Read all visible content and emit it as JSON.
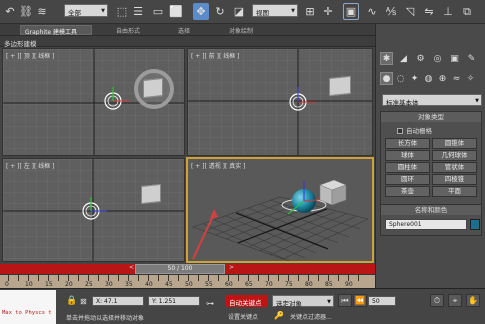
{
  "toolbar": {
    "filter_select": "全部",
    "coord_select": "视图",
    "icons": [
      "undo",
      "redo",
      "link",
      "unlink",
      "bind-spacewarp",
      "select-object",
      "select-by-name",
      "rect-select",
      "window-crossing",
      "move",
      "rotate",
      "scale",
      "use-pivot",
      "select-manipulate",
      "snap-3d",
      "angle-snap",
      "percent-snap",
      "spinner-snap",
      "mirror",
      "align",
      "layer",
      "graphite",
      "curve-editor",
      "schematic",
      "material-editor",
      "render-setup",
      "render-frame",
      "render"
    ]
  },
  "ribbon": {
    "tabs": [
      "Graphite 建模工具",
      "自由形式",
      "选择",
      "对象绘制"
    ],
    "sub_label": "多边形建模"
  },
  "viewports": {
    "top": "[ + ][ 顶 ][ 线框 ]",
    "front": "[ + ][ 前 ][ 线框 ]",
    "left": "[ + ][ 左 ][ 线框 ]",
    "persp": "[ + ][ 透视 ][ 真实 ]"
  },
  "timeline": {
    "slider_label": "50 / 100",
    "ticks": [
      "0",
      "10",
      "15",
      "20",
      "25",
      "30",
      "35",
      "40",
      "45",
      "50",
      "55",
      "60",
      "65",
      "70",
      "75",
      "80",
      "85",
      "90"
    ]
  },
  "status": {
    "maxscript": "Max to Physcs t",
    "coords_label": "X: 47.1",
    "y_label": "Y: 1.251",
    "prompt": "单击并拖动以选择并移动对象",
    "autokey": "自动关键点",
    "setkey": "设置关键点",
    "key_select": "选定对象",
    "key_filters": "关键点过滤器...",
    "frame_value": "50"
  },
  "command_panel": {
    "tabs": [
      "create",
      "modify",
      "hierarchy",
      "motion",
      "display",
      "utilities"
    ],
    "sub_icons": [
      "geometry",
      "shapes",
      "lights",
      "cameras",
      "helpers",
      "spacewarps",
      "systems"
    ],
    "category": "标准基本体",
    "object_type_header": "对象类型",
    "autogrid": "自动栅格",
    "buttons": [
      [
        "长方体",
        "圆锥体"
      ],
      [
        "球体",
        "几何球体"
      ],
      [
        "圆柱体",
        "管状体"
      ],
      [
        "圆环",
        "四棱锥"
      ],
      [
        "茶壶",
        "平面"
      ]
    ],
    "name_color_header": "名称和颜色",
    "object_name": "Sphere001",
    "object_color": "#1a6f8c"
  }
}
